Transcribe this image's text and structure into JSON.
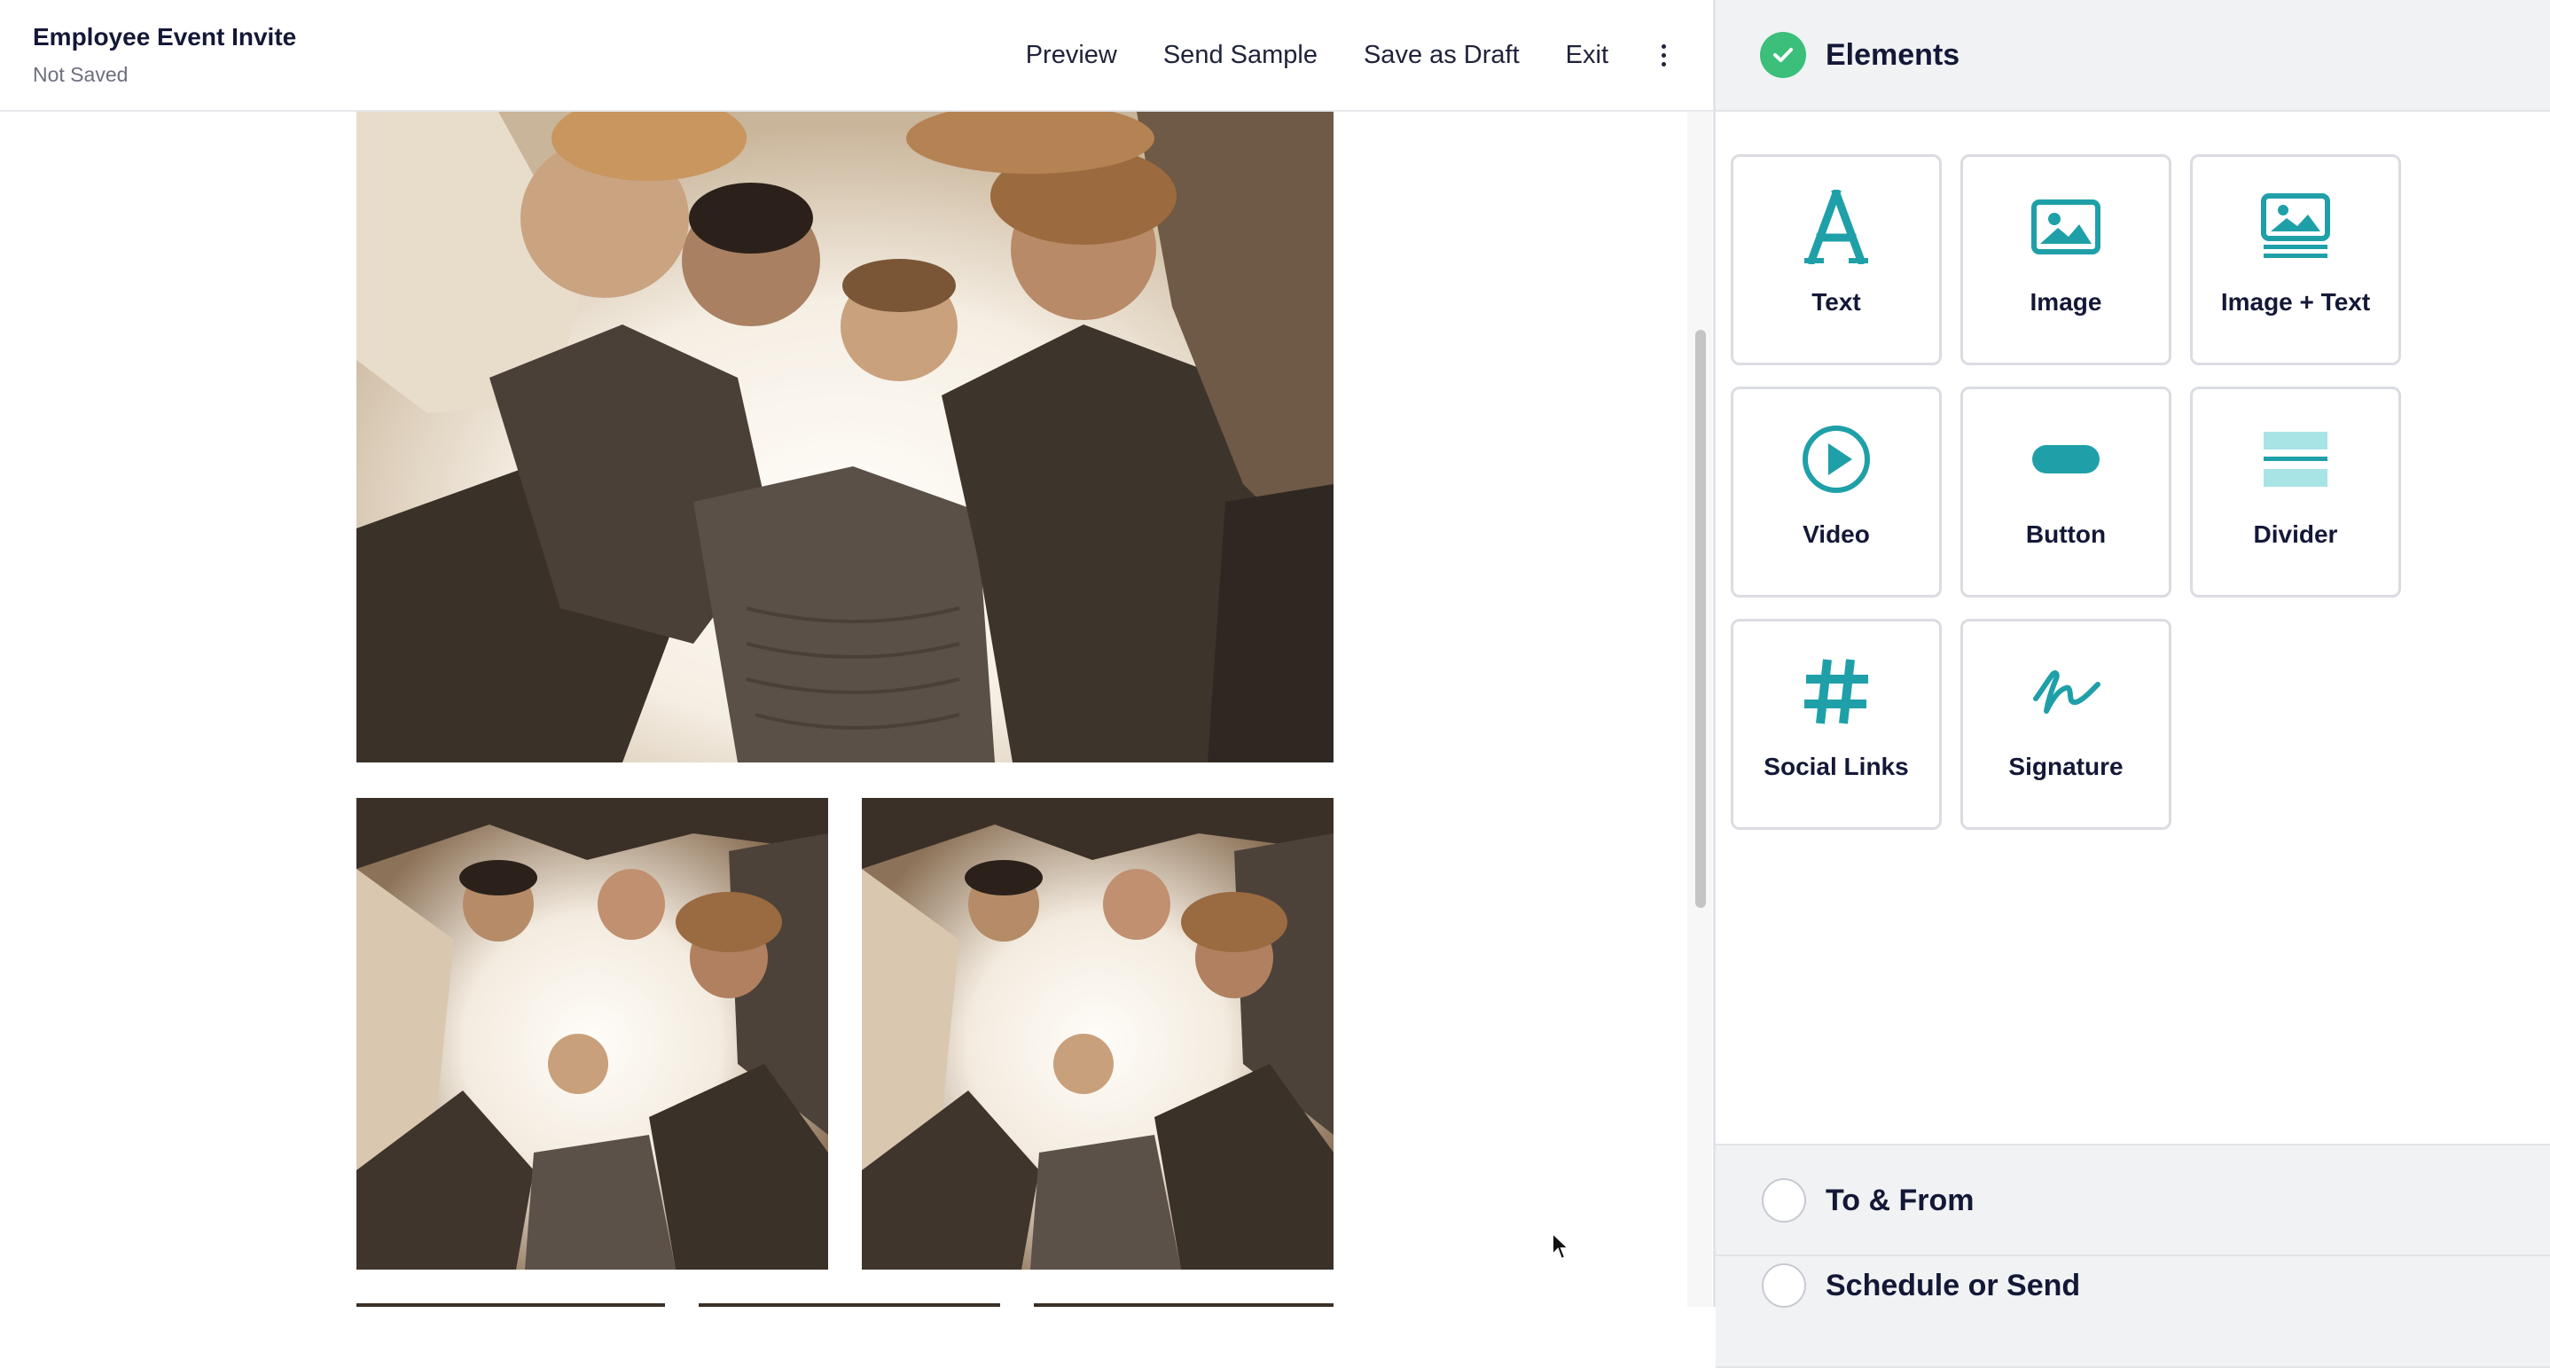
{
  "header": {
    "title": "Employee Event Invite",
    "status": "Not Saved",
    "actions": [
      "Preview",
      "Send Sample",
      "Save as Draft",
      "Exit"
    ],
    "more_icon": "kebab-vertical-icon"
  },
  "canvas": {
    "images": [
      {
        "alt": "Group of people in a huddle photographed from below"
      },
      {
        "alt": "Group huddle photo, left column"
      },
      {
        "alt": "Group huddle photo, right column"
      }
    ]
  },
  "panel": {
    "elements_section": {
      "title": "Elements",
      "status_icon": "check-circle-icon",
      "items": [
        {
          "label": "Text",
          "icon": "text-icon"
        },
        {
          "label": "Image",
          "icon": "image-icon"
        },
        {
          "label": "Image + Text",
          "icon": "image-text-icon"
        },
        {
          "label": "Video",
          "icon": "play-circle-icon"
        },
        {
          "label": "Button",
          "icon": "button-icon"
        },
        {
          "label": "Divider",
          "icon": "divider-icon"
        },
        {
          "label": "Social Links",
          "icon": "hashtag-icon"
        },
        {
          "label": "Signature",
          "icon": "signature-icon"
        }
      ]
    },
    "to_from_section": {
      "title": "To & From"
    },
    "schedule_section": {
      "title": "Schedule or Send"
    }
  },
  "colors": {
    "accent": "#1fa0a8",
    "complete": "#3bbf7a",
    "title_text": "#141837",
    "panel_header_bg": "#f1f2f4"
  }
}
